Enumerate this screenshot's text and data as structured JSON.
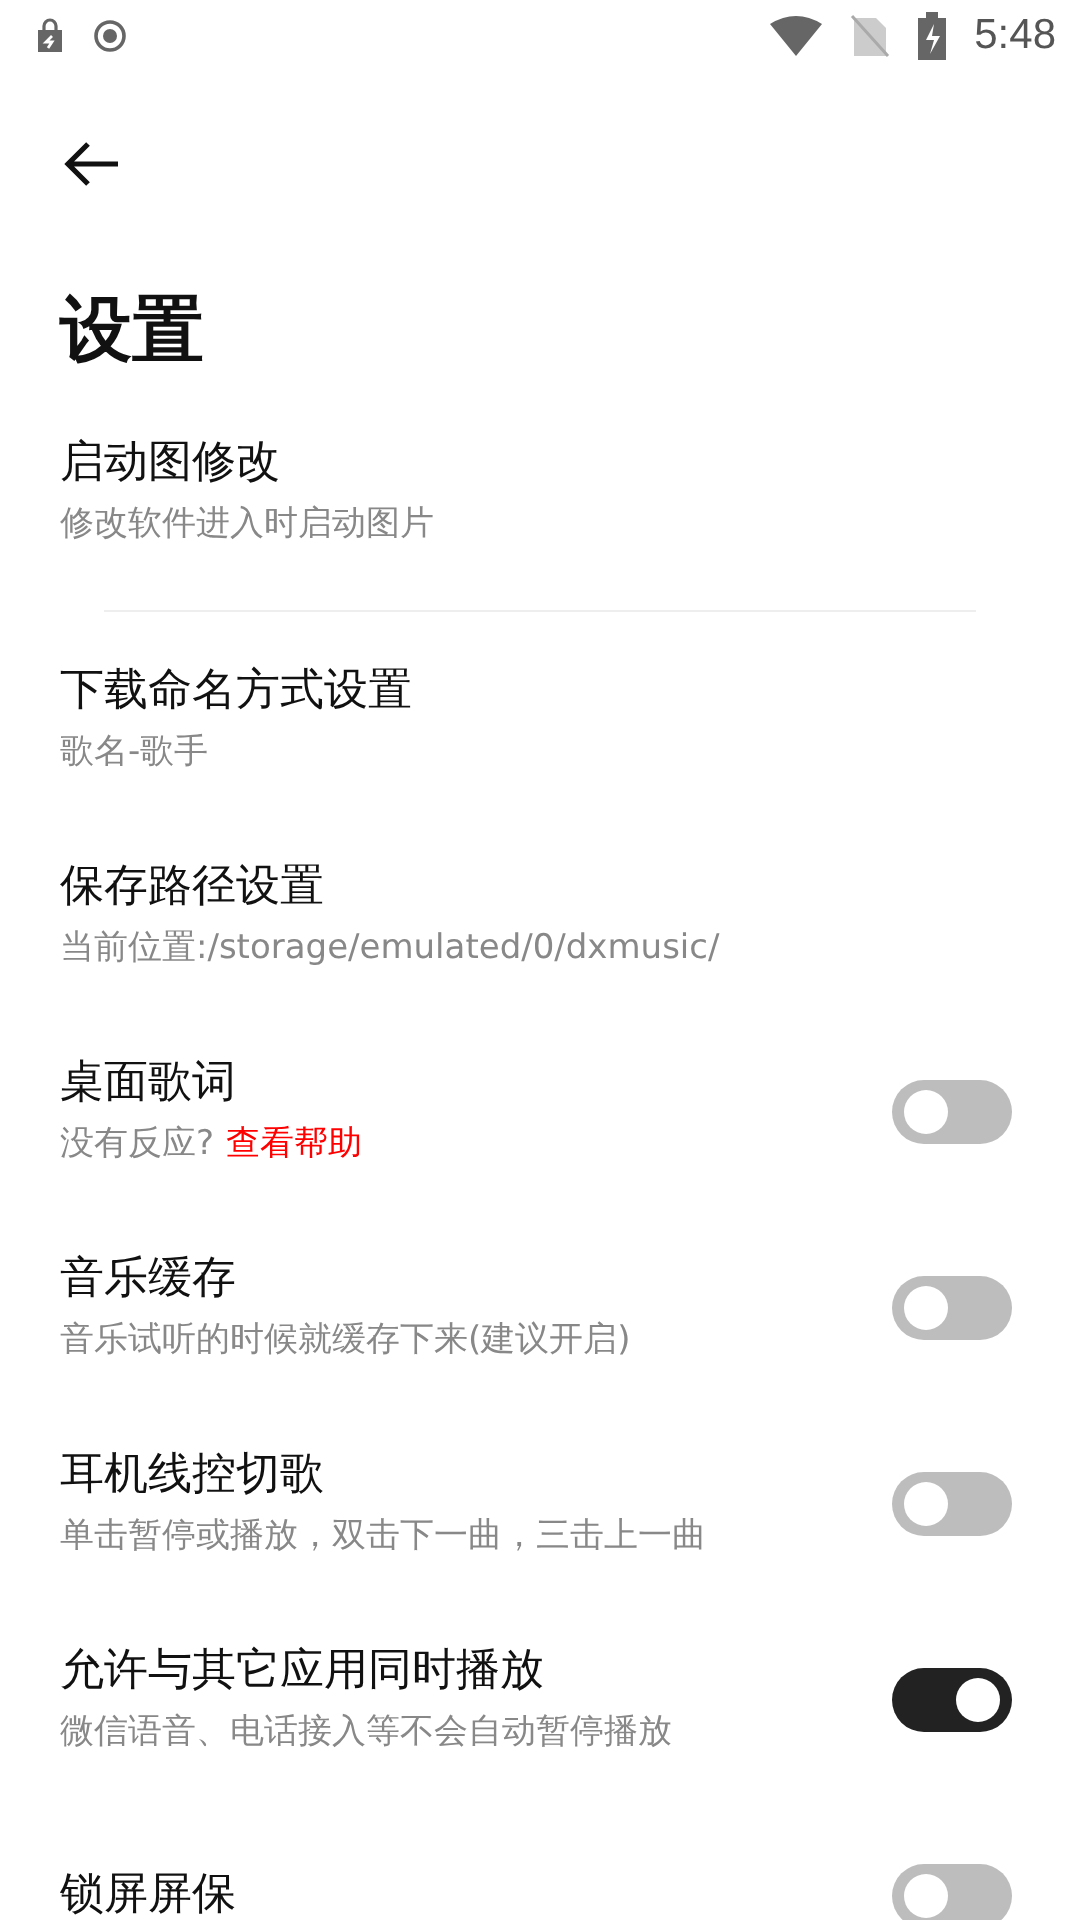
{
  "status_bar": {
    "time": "5:48"
  },
  "page": {
    "title": "设置"
  },
  "items": [
    {
      "kind": "text",
      "title": "启动图修改",
      "subtitle": "修改软件进入时启动图片",
      "divider": true
    },
    {
      "kind": "text",
      "title": "下载命名方式设置",
      "subtitle": "歌名-歌手",
      "divider": false
    },
    {
      "kind": "text",
      "title": "保存路径设置",
      "subtitle": "当前位置:/storage/emulated/0/dxmusic/",
      "divider": false
    },
    {
      "kind": "toggle",
      "title": "桌面歌词",
      "subtitle": "没有反应?",
      "link": "查看帮助",
      "on": false,
      "divider": false
    },
    {
      "kind": "toggle",
      "title": "音乐缓存",
      "subtitle": "音乐试听的时候就缓存下来(建议开启)",
      "on": false,
      "divider": false
    },
    {
      "kind": "toggle",
      "title": "耳机线控切歌",
      "subtitle": "单击暂停或播放，双击下一曲，三击上一曲",
      "on": false,
      "divider": false
    },
    {
      "kind": "toggle",
      "title": "允许与其它应用同时播放",
      "subtitle": "微信语音、电话接入等不会自动暂停播放",
      "on": true,
      "divider": false
    },
    {
      "kind": "toggle",
      "title": "锁屏屏保",
      "on": false,
      "divider": false
    }
  ]
}
